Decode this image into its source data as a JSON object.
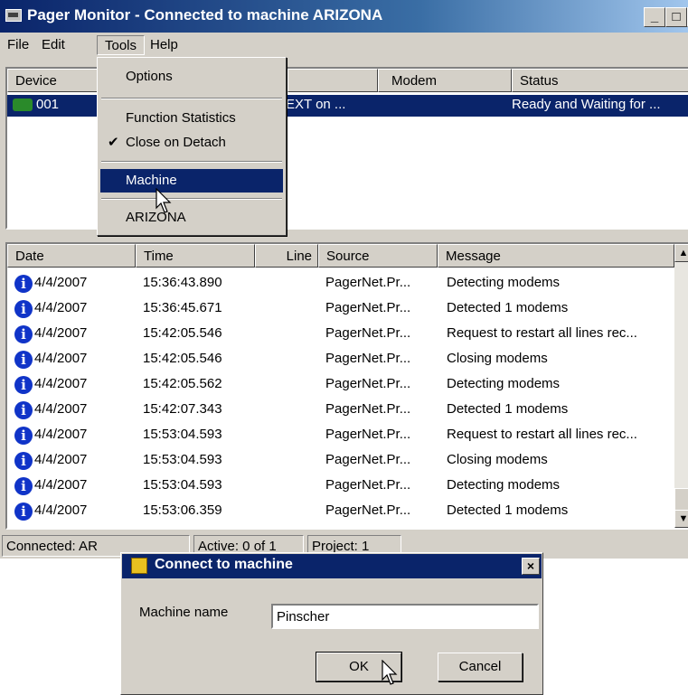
{
  "window": {
    "title": "Pager Monitor - Connected to machine ARIZONA"
  },
  "title_buttons": {
    "minimize": "_",
    "maximize": "□",
    "close": "×"
  },
  "menu": [
    "File",
    "Edit",
    "Tools",
    "Help"
  ],
  "device_list": {
    "columns": [
      "Device",
      "Modem",
      "Status"
    ],
    "rows": [
      {
        "device": "001",
        "modem_partial": "EXT on ...",
        "status": "Ready and Waiting for ..."
      }
    ]
  },
  "log_list": {
    "columns": [
      "Date",
      "Time",
      "Line",
      "Source",
      "Message"
    ],
    "rows": [
      {
        "date": "4/4/2007",
        "time": "15:36:43.890",
        "source": "PagerNet.Pr...",
        "message": "Detecting modems"
      },
      {
        "date": "4/4/2007",
        "time": "15:36:45.671",
        "source": "PagerNet.Pr...",
        "message": "Detected 1  modems"
      },
      {
        "date": "4/4/2007",
        "time": "15:42:05.546",
        "source": "PagerNet.Pr...",
        "message": "Request to restart all lines rec..."
      },
      {
        "date": "4/4/2007",
        "time": "15:42:05.546",
        "source": "PagerNet.Pr...",
        "message": "Closing modems"
      },
      {
        "date": "4/4/2007",
        "time": "15:42:05.562",
        "source": "PagerNet.Pr...",
        "message": "Detecting modems"
      },
      {
        "date": "4/4/2007",
        "time": "15:42:07.343",
        "source": "PagerNet.Pr...",
        "message": "Detected 1  modems"
      },
      {
        "date": "4/4/2007",
        "time": "15:53:04.593",
        "source": "PagerNet.Pr...",
        "message": "Request to restart all lines rec..."
      },
      {
        "date": "4/4/2007",
        "time": "15:53:04.593",
        "source": "PagerNet.Pr...",
        "message": "Closing modems"
      },
      {
        "date": "4/4/2007",
        "time": "15:53:04.593",
        "source": "PagerNet.Pr...",
        "message": "Detecting modems"
      },
      {
        "date": "4/4/2007",
        "time": "15:53:06.359",
        "source": "PagerNet.Pr...",
        "message": "Detected 1  modems"
      }
    ]
  },
  "status_bar": [
    "Connected: AR",
    "Active: 0 of 1",
    "Project: 1"
  ],
  "tools_menu": {
    "items": [
      "Options",
      "Function Statistics",
      "Close on Detach",
      "Machine",
      "ARIZONA"
    ],
    "checked": "Close on Detach",
    "highlighted": "Machine"
  },
  "dialog": {
    "title": "Connect to machine",
    "close": "×",
    "label": "Machine name",
    "value": "Pinscher",
    "ok": "OK",
    "cancel": "Cancel"
  },
  "colors": {
    "selection": "#0a246a",
    "face": "#d4d0c8",
    "info_icon": "#1034c8"
  }
}
